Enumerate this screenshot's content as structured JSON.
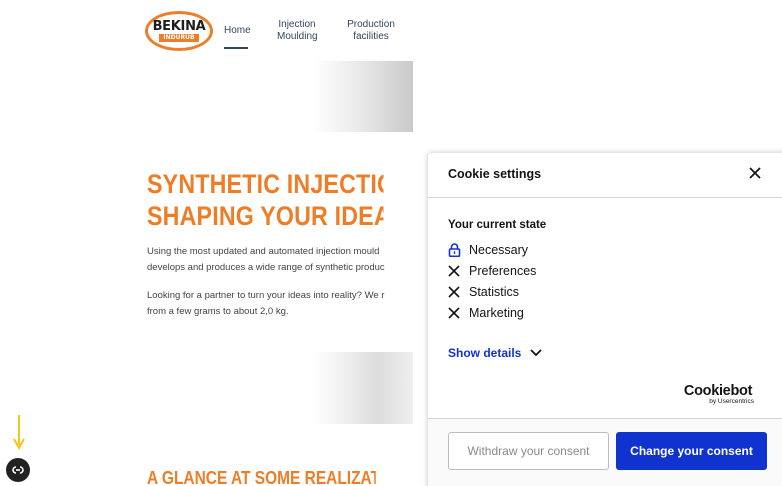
{
  "site": {
    "logo": {
      "main": "BEKINA",
      "sub": "INDURUB"
    },
    "nav": [
      {
        "label": "Home",
        "active": true
      },
      {
        "label": "Injection\nMoulding"
      },
      {
        "label": "Production\nfacilities"
      }
    ],
    "hero": {
      "title": "SYNTHETIC INJECTION MOU\nSHAPING YOUR IDEAS",
      "p1": "Using the most updated and automated injection mould\ndevelops and produces a wide range of synthetic produc",
      "p2": "Looking for a partner to turn your ideas into reality? We r\nfrom a few grams to about 2,0 kg."
    },
    "section_title": "A GLANCE AT SOME REALIZATIONS"
  },
  "cookie": {
    "title": "Cookie settings",
    "close_icon": "close-icon",
    "state_title": "Your current state",
    "items": [
      {
        "label": "Necessary",
        "icon": "lock-icon"
      },
      {
        "label": "Preferences",
        "icon": "x-icon"
      },
      {
        "label": "Statistics",
        "icon": "x-icon"
      },
      {
        "label": "Marketing",
        "icon": "x-icon"
      }
    ],
    "show_details": "Show details",
    "brand": {
      "main": "Cookiebot",
      "sub": "by Usercentrics"
    },
    "withdraw_label": "Withdraw your consent",
    "change_label": "Change your consent"
  },
  "colors": {
    "brand_orange": "#ee7d27",
    "cookie_blue": "#1032cf",
    "arrow_yellow": "#f5c518"
  }
}
